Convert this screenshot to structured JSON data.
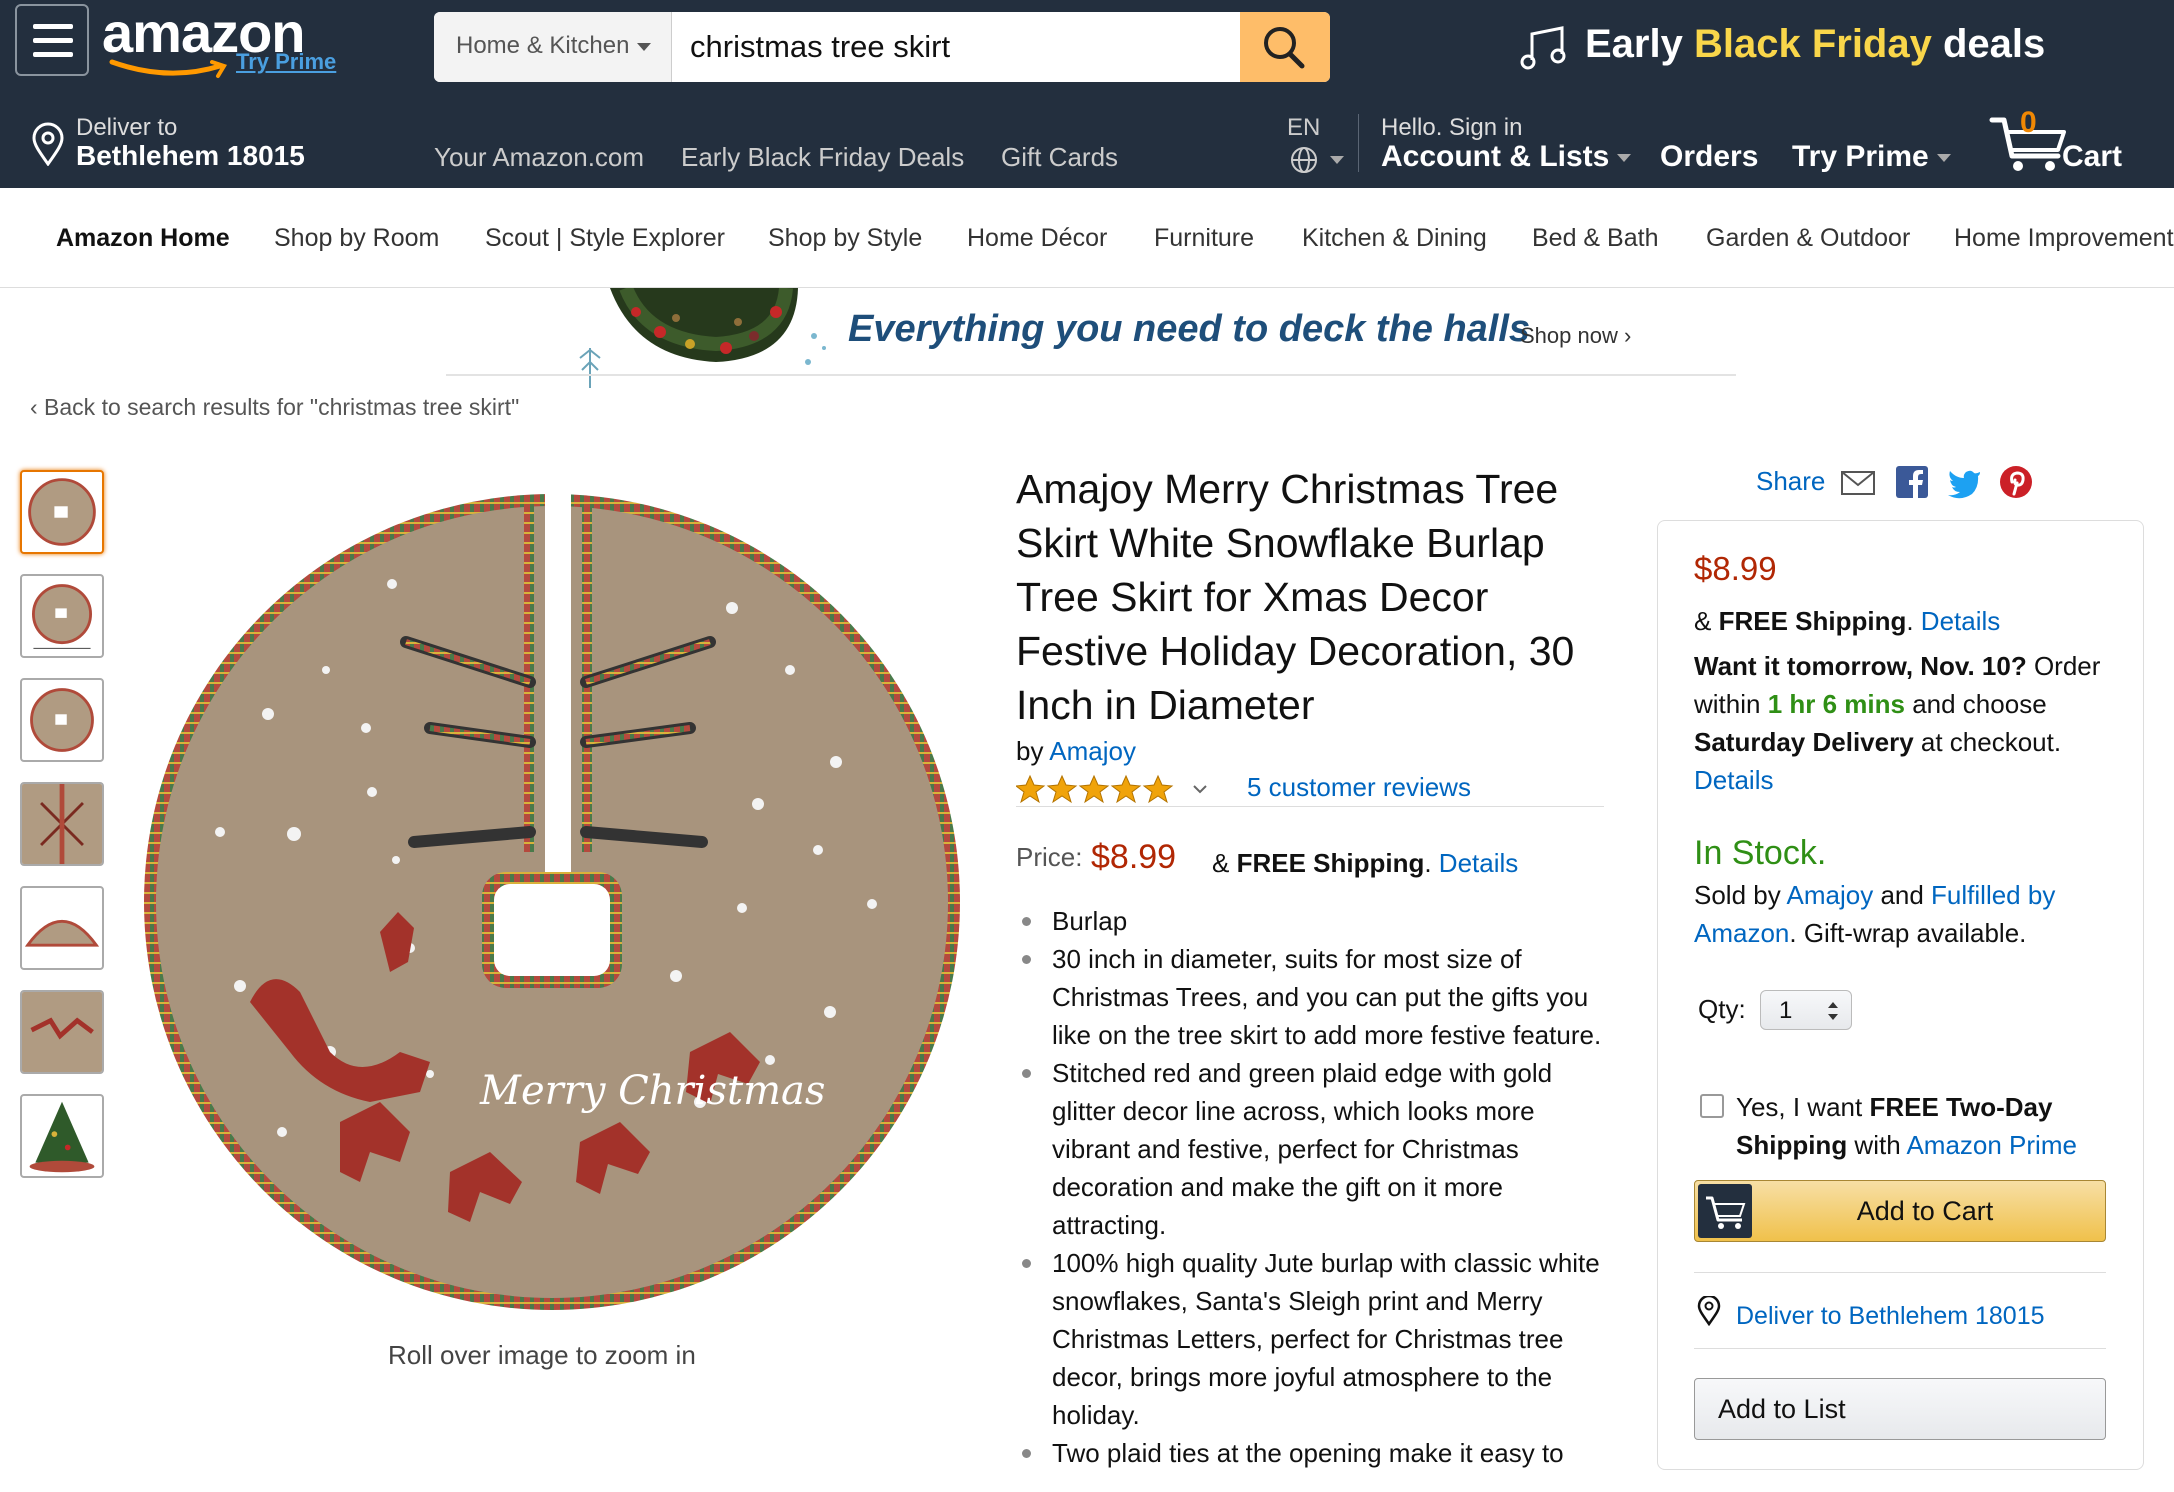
{
  "header": {
    "logo": "amazon",
    "try_prime": "Try Prime",
    "search": {
      "category": "Home & Kitchen",
      "query": "christmas tree skirt"
    },
    "promo": {
      "part1": "Early ",
      "part2": "Black Friday",
      "part3": " deals"
    },
    "deliver_to_label": "Deliver to",
    "deliver_to_location": "Bethlehem 18015",
    "nav_links": [
      "Your Amazon.com",
      "Early Black Friday Deals",
      "Gift Cards"
    ],
    "language": "EN",
    "greeting": "Hello. Sign in",
    "account": "Account & Lists",
    "orders": "Orders",
    "try_prime_menu": "Try Prime",
    "cart_count": "0",
    "cart_label": "Cart"
  },
  "subnav": [
    "Amazon Home",
    "Shop by Room",
    "Scout | Style Explorer",
    "Shop by Style",
    "Home Décor",
    "Furniture",
    "Kitchen & Dining",
    "Bed & Bath",
    "Garden & Outdoor",
    "Home Improvement"
  ],
  "banner": {
    "headline": "Everything you need to deck the halls",
    "cta": "Shop now ›"
  },
  "breadcrumb": "‹  Back to search results for \"christmas tree skirt\"",
  "gallery": {
    "zoom_hint": "Roll over image to zoom in",
    "image_text": "Merry Christmas"
  },
  "product": {
    "title": "Amajoy Merry Christmas Tree Skirt White Snowflake Burlap Tree Skirt for Xmas Decor Festive Holiday Decoration, 30 Inch in Diameter",
    "by_label": "by ",
    "brand": "Amajoy",
    "rating_stars": 5,
    "reviews": "5 customer reviews",
    "price_label": "Price:",
    "price": "$8.99",
    "shipping_prefix": "& ",
    "shipping": "FREE Shipping",
    "shipping_sep": ". ",
    "details": "Details",
    "bullets": [
      "Burlap",
      "30 inch in diameter, suits for most size of Christmas Trees, and you can put the gifts you like on the tree skirt to add more festive feature.",
      "Stitched red and green plaid edge with gold glitter decor line across, which looks more vibrant and festive, perfect for Christmas decoration and make the gift on it more attracting.",
      "100% high quality Jute burlap with classic white snowflakes, Santa's Sleigh print and Merry Christmas Letters, perfect for Christmas tree decor, brings more joyful atmosphere to the holiday.",
      "Two plaid ties at the opening make it easy to"
    ]
  },
  "share_label": "Share",
  "buybox": {
    "price": "$8.99",
    "shipping_prefix": "& ",
    "shipping": "FREE Shipping",
    "shipping_sep": ". ",
    "details": "Details",
    "want_it": "Want it tomorrow, Nov. 10?",
    "order_within": " Order within ",
    "countdown": "1 hr 6 mins",
    "and_choose": " and choose ",
    "saturday": "Saturday Delivery",
    "at_checkout": " at checkout.",
    "details2": "Details",
    "in_stock": "In Stock.",
    "sold_by": "Sold by ",
    "seller": "Amajoy",
    "and": " and ",
    "fulfilled": "Fulfilled by Amazon",
    "gift_wrap": ". Gift-wrap available.",
    "qty_label": "Qty:",
    "qty_value": "1",
    "two_day_pre": "Yes, I want ",
    "two_day_bold": "FREE Two-Day Shipping",
    "two_day_mid": " with ",
    "two_day_link": "Amazon Prime",
    "add_to_cart": "Add to Cart",
    "deliver_to": "Deliver to Bethlehem 18015",
    "add_to_list": "Add to List"
  },
  "colors": {
    "header_bg": "#232f3e",
    "link": "#0066c0",
    "price": "#b12704",
    "stock": "#2f8f15",
    "cart_button": "#f0c14b",
    "search_button": "#febd69"
  }
}
